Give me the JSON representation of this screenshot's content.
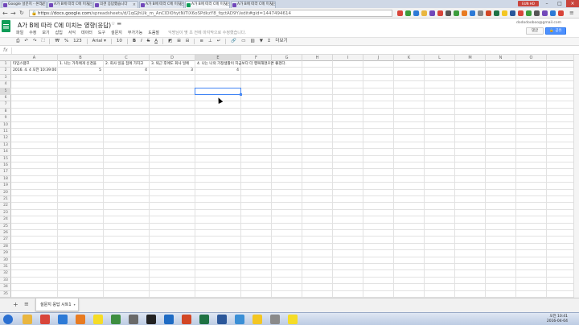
{
  "browser": {
    "tabs": [
      {
        "label": "Google 설문지 - 온라인 설",
        "favicon": "forms-icon",
        "color": "#7248b9",
        "active": false
      },
      {
        "label": "A가 B에 따라 C에 미치는",
        "favicon": "forms-icon",
        "color": "#7248b9",
        "active": false
      },
      {
        "label": "의견 응답했습니다",
        "favicon": "forms-icon",
        "color": "#7248b9",
        "active": false
      },
      {
        "label": "A가 B에 따라 C에 미치는",
        "favicon": "forms-icon",
        "color": "#7248b9",
        "active": false
      },
      {
        "label": "A가 B에 따라 C에 미치는",
        "favicon": "sheets-icon",
        "color": "#0f9d58",
        "active": true
      },
      {
        "label": "A가 B에 따라 C에 미치는",
        "favicon": "forms-icon",
        "color": "#7248b9",
        "active": false
      }
    ],
    "user_badge": "EUN HO",
    "url_host": "https://docs.google.com",
    "url_path": "/spreadsheets/d/1qGJhUk_m_AnClDl0hytNiTiX6oSPdkzY8_fqctAD9Y/edit#gid=1447494614"
  },
  "app": {
    "title": "A가 B에 따라 C에 미치는 영향(응답)",
    "menu": [
      "파일",
      "수정",
      "보기",
      "삽입",
      "서식",
      "데이터",
      "도구",
      "설문지",
      "부가기능",
      "도움말"
    ],
    "notice": "익명님이 몇 초 전에 마지막으로 수정했습니다.",
    "user_email": "dododooboo@gmail.com",
    "comment_label": "댓글",
    "share_label": "공유",
    "share_color": "#4d90fe"
  },
  "toolbar": {
    "zoom_items": [
      "₩",
      "%",
      "123"
    ],
    "font": "Arial",
    "font_size": "10",
    "bold": "B",
    "italic": "I",
    "strike": "S",
    "text_color": "A",
    "more": "더보기"
  },
  "formula_bar": {
    "fx": "fx",
    "value": ""
  },
  "sheet": {
    "columns": [
      "A",
      "B",
      "C",
      "D",
      "E",
      "F",
      "G",
      "H",
      "I",
      "J",
      "K",
      "L",
      "M",
      "N",
      "O"
    ],
    "row_count": 35,
    "header_row": [
      "타임스탬프",
      "1. 나는 가족에게 신경을",
      "2. 회사 일을 집에 가지고",
      "3. 퇴근 후에도 회사 일에",
      "4. 나는 나의 가정생활이 지금보다 더 행복해졌으면 좋겠다."
    ],
    "data_row": [
      "2016. 4. 4 오전 10:39:00",
      "5",
      "4",
      "3",
      "4"
    ],
    "selected_cell": "E5"
  },
  "sheet_tabs": {
    "add": "+",
    "list": "≡",
    "active_tab": "설문지 응답 시트1"
  },
  "taskbar": {
    "icons": [
      {
        "name": "start-icon",
        "color": "#2a6fd1"
      },
      {
        "name": "explorer-icon",
        "color": "#e9b640"
      },
      {
        "name": "chrome-icon",
        "color": "#d8453a"
      },
      {
        "name": "ie-icon",
        "color": "#2d7ad6"
      },
      {
        "name": "firefox-icon",
        "color": "#e87b22"
      },
      {
        "name": "kakao-icon",
        "color": "#f5dc27"
      },
      {
        "name": "app-icon",
        "color": "#3e8e41"
      },
      {
        "name": "media-icon",
        "color": "#6a6a6a"
      },
      {
        "name": "camera-icon",
        "color": "#222222"
      },
      {
        "name": "outlook-icon",
        "color": "#1e6bc4"
      },
      {
        "name": "powerpoint-icon",
        "color": "#d24726"
      },
      {
        "name": "excel-icon",
        "color": "#1f7244"
      },
      {
        "name": "word-icon",
        "color": "#2b579a"
      },
      {
        "name": "hwp-icon",
        "color": "#3a8fd6"
      },
      {
        "name": "star-icon",
        "color": "#f3c623"
      },
      {
        "name": "notes-icon",
        "color": "#8a8a8a"
      },
      {
        "name": "chat-icon",
        "color": "#f5dc27"
      }
    ],
    "time": "오전 10:41",
    "date": "2016-04-04"
  }
}
